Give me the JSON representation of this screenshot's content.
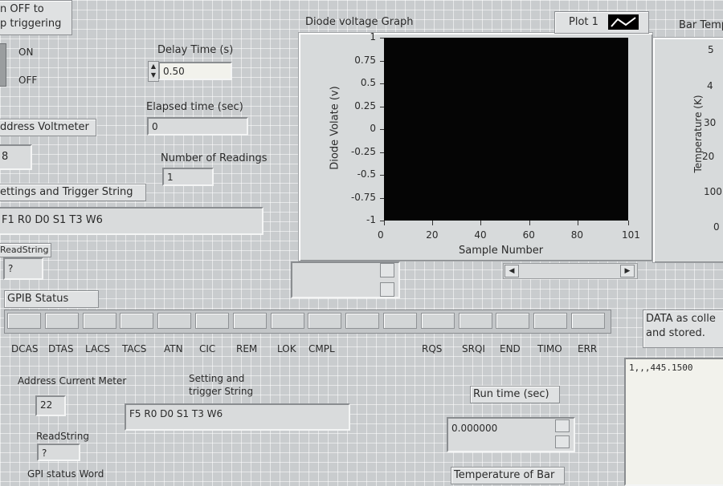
{
  "top_left": {
    "toggle_caption_line1": "n OFF to",
    "toggle_caption_line2": "p triggering",
    "on_label": "ON",
    "off_label": "OFF"
  },
  "delay": {
    "label": "Delay Time (s)",
    "value": "0.50"
  },
  "elapsed": {
    "label": "Elapsed time (sec)",
    "value": "0"
  },
  "voltmeter": {
    "label": "ddress Voltmeter",
    "value": "8"
  },
  "readings": {
    "label": "Number of Readings",
    "value": "1"
  },
  "settings": {
    "label": "ettings and Trigger String",
    "value": "F1 R0 D0 S1 T3 W6"
  },
  "readstring1": {
    "label": "ReadString",
    "value": "?"
  },
  "graph": {
    "title": "Diode voltage Graph",
    "legend_label": "Plot 1",
    "xlabel": "Sample Number",
    "ylabel": "Diode Volate (v)"
  },
  "chart_data": {
    "type": "line",
    "title": "Diode voltage Graph",
    "xlabel": "Sample Number",
    "ylabel": "Diode Volate (v)",
    "xlim": [
      0,
      101
    ],
    "ylim": [
      -1,
      1
    ],
    "x_ticks": [
      "0",
      "20",
      "40",
      "60",
      "80",
      "101"
    ],
    "y_ticks": [
      "1",
      "0.75",
      "0.5",
      "0.25",
      "0",
      "-0.25",
      "-0.5",
      "-0.75",
      "-1"
    ],
    "series": [
      {
        "name": "Plot 1",
        "values": []
      }
    ]
  },
  "bar_temp": {
    "title": "Bar Temp",
    "ylabel": "Temperature (K)",
    "ticks": [
      "5",
      "4",
      "30",
      "20",
      "100",
      "0"
    ]
  },
  "gpib": {
    "label": "GPIB Status",
    "flags": [
      "DCAS",
      "DTAS",
      "LACS",
      "TACS",
      "ATN",
      "CIC",
      "REM",
      "LOK",
      "CMPL",
      "RQS",
      "SRQI",
      "END",
      "TIMO",
      "ERR"
    ]
  },
  "data_panel": {
    "label_line1": "DATA as colle",
    "label_line2": "and stored.",
    "value": "1,,,445.1500"
  },
  "current_meter": {
    "label": "Address Current Meter",
    "value": "22"
  },
  "setting2": {
    "label_line1": "Setting and",
    "label_line2": "trigger String",
    "value": "F5 R0 D0 S1 T3 W6"
  },
  "readstring2": {
    "label": "ReadString",
    "value": "?"
  },
  "gpi_word": {
    "label": "GPI status Word"
  },
  "runtime": {
    "label": "Run time (sec)",
    "value": "0.000000"
  },
  "temp_bar": {
    "label": "Temperature of Bar"
  }
}
